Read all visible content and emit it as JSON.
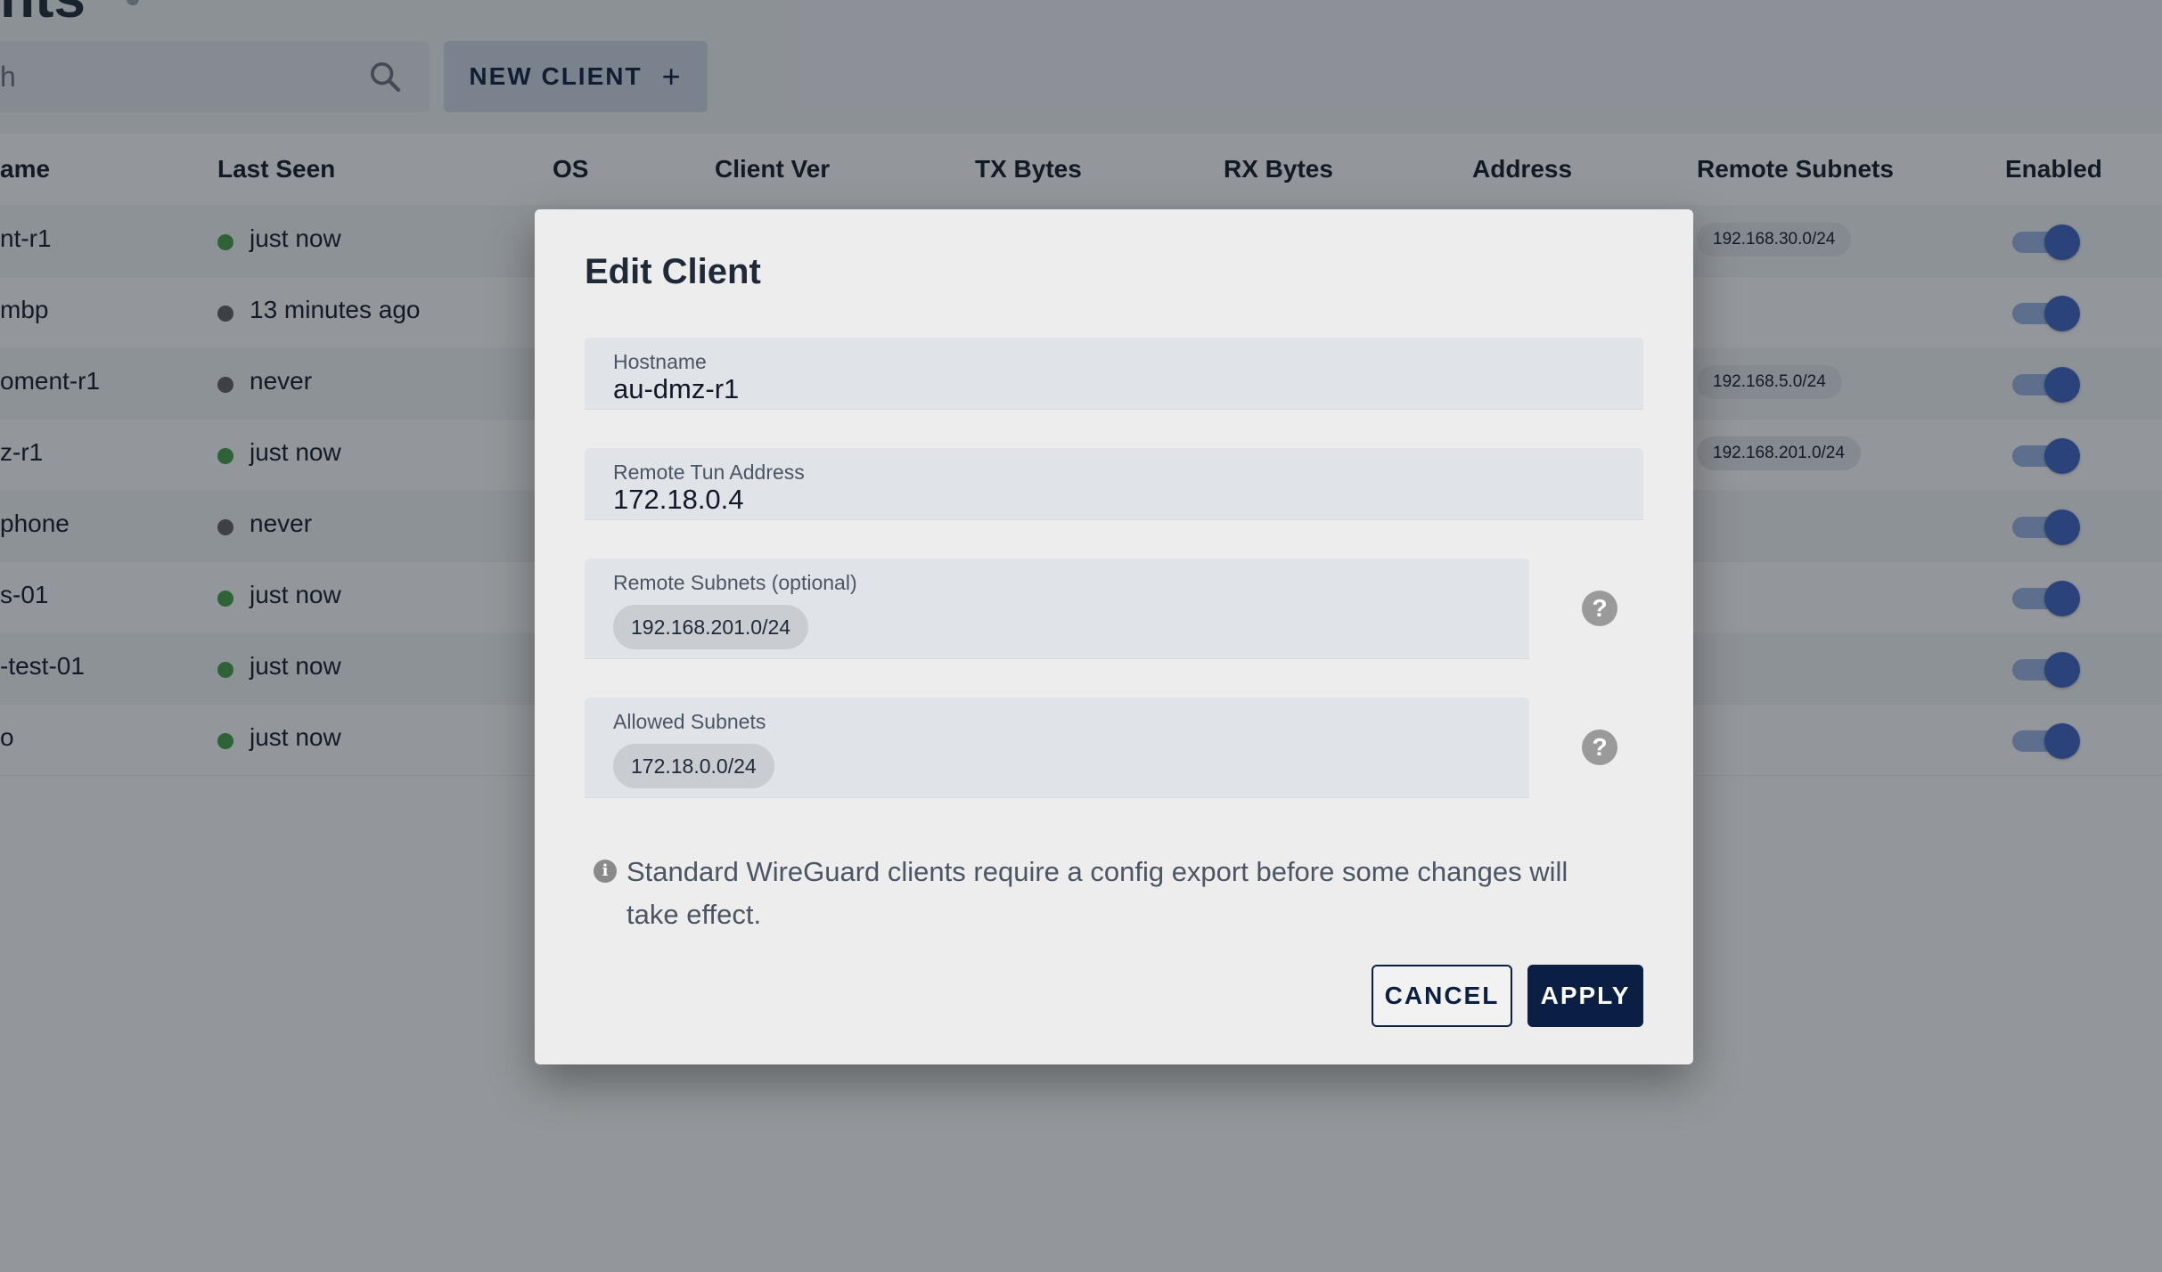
{
  "page": {
    "title_fragment": "nts",
    "search": {
      "text_fragment": "h"
    },
    "new_client_label": "NEW CLIENT",
    "new_client_icon": "plus-icon",
    "columns": [
      "ame",
      "Last Seen",
      "OS",
      "Client Ver",
      "TX Bytes",
      "RX Bytes",
      "Address",
      "Remote Subnets",
      "Enabled"
    ],
    "rows": [
      {
        "name": "nt-r1",
        "last_seen": "just now",
        "status": "online",
        "subnet": "192.168.30.0/24"
      },
      {
        "name": "mbp",
        "last_seen": "13 minutes ago",
        "status": "offline",
        "subnet": ""
      },
      {
        "name": "oment-r1",
        "last_seen": "never",
        "status": "offline",
        "subnet": "192.168.5.0/24"
      },
      {
        "name": "z-r1",
        "last_seen": "just now",
        "status": "online",
        "subnet": "192.168.201.0/24"
      },
      {
        "name": "phone",
        "last_seen": "never",
        "status": "offline",
        "subnet": ""
      },
      {
        "name": "s-01",
        "last_seen": "just now",
        "status": "online",
        "subnet": ""
      },
      {
        "name": "-test-01",
        "last_seen": "just now",
        "status": "online",
        "subnet": ""
      },
      {
        "name": "o",
        "last_seen": "just now",
        "status": "online",
        "subnet": ""
      }
    ],
    "colors": {
      "online": "#43a047",
      "offline": "#616161",
      "toggle": "#3d64c4"
    }
  },
  "dialog": {
    "title": "Edit Client",
    "hostname": {
      "label": "Hostname",
      "value": "au-dmz-r1"
    },
    "tun_address": {
      "label": "Remote Tun Address",
      "value": "172.18.0.4"
    },
    "remote_subnets": {
      "label": "Remote Subnets (optional)",
      "chips": [
        "192.168.201.0/24"
      ]
    },
    "allowed_subnets": {
      "label": "Allowed Subnets",
      "chips": [
        "172.18.0.0/24"
      ]
    },
    "help_icon": "help-icon",
    "info_icon": "info-icon",
    "info_text": "Standard WireGuard clients require a config export before some changes will take effect.",
    "cancel_label": "CANCEL",
    "apply_label": "APPLY",
    "colors": {
      "primary": "#0b1f44"
    }
  }
}
